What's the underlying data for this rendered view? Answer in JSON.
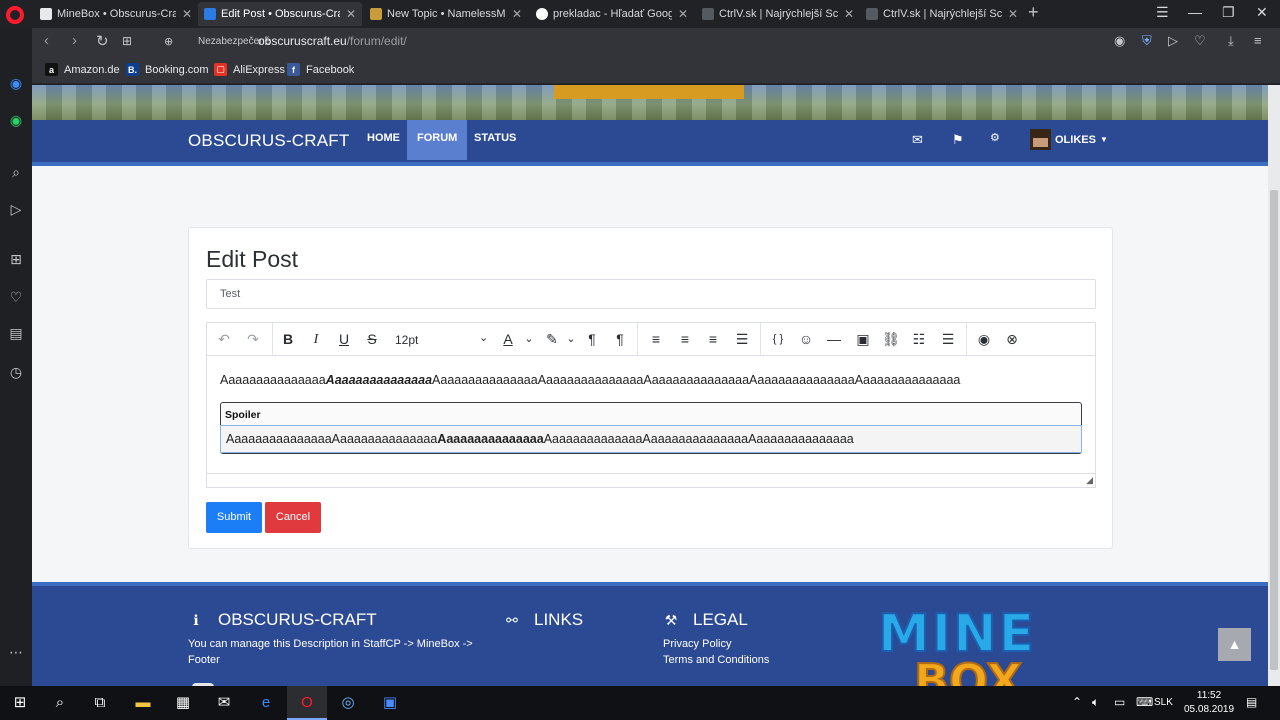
{
  "browser": {
    "tabs": [
      {
        "title": "MineBox • Obscurus-Craft",
        "favicon_color": "#e8e9eb"
      },
      {
        "title": "Edit Post • Obscurus-Craft",
        "favicon_color": "#2c7be5"
      },
      {
        "title": "New Topic • NamelessMC",
        "favicon_color": "#c89b3c"
      },
      {
        "title": "prekladac - Hľadať Googlom",
        "favicon_color": "#ffffff"
      },
      {
        "title": "CtrlV.sk | Najrýchlejší Screen",
        "favicon_color": "#555a60"
      },
      {
        "title": "CtrlV.sk | Najrýchlejší Screen",
        "favicon_color": "#555a60"
      }
    ],
    "security_label": "Nezabezpečené",
    "url_host": "obscuruscraft.eu",
    "url_path": "/forum/edit/",
    "bookmarks": [
      {
        "label": "Amazon.de",
        "icon": "a",
        "color": "#111111"
      },
      {
        "label": "Booking.com",
        "icon": "B.",
        "color": "#0b3f91"
      },
      {
        "label": "AliExpress",
        "icon": "▢",
        "color": "#e43225"
      },
      {
        "label": "Facebook",
        "icon": "f",
        "color": "#3b5998"
      }
    ]
  },
  "site": {
    "brand": "OBSCURUS-CRAFT",
    "nav": [
      {
        "label": "HOME"
      },
      {
        "label": "FORUM"
      },
      {
        "label": "STATUS"
      }
    ],
    "username": "OLIKES"
  },
  "editor": {
    "page_title": "Edit Post",
    "topic_title_value": "Test",
    "font_size": "12pt",
    "paragraph": {
      "part1": "Aaaaaaaaaaaaaaa",
      "bold": "Aaaaaaaaaaaaaaa",
      "part2": "AaaaaaaaaaaaaaaAaaaaaaaaaaaaaaAaaaaaaaaaaaaaaAaaaaaaaaaaaaaaAaaaaaaaaaaaaaa"
    },
    "spoiler": {
      "label": "Spoiler",
      "part1": "AaaaaaaaaaaaaaaAaaaaaaaaaaaaaa",
      "bold": "Aaaaaaaaaaaaaaa",
      "part2": "AaaaaaaaaaaaaaAaaaaaaaaaaaaaaAaaaaaaaaaaaaaa"
    },
    "submit_label": "Submit",
    "cancel_label": "Cancel"
  },
  "footer": {
    "col1_title": "OBSCURUS-CRAFT",
    "col1_text_line1": "You can manage this Description in StaffCP -> MineBox ->",
    "col1_text_line2": "Footer",
    "col2_title": "LINKS",
    "col3_title": "LEGAL",
    "legal_links": [
      "Privacy Policy",
      "Terms and Conditions"
    ],
    "logo_line1": "MINE",
    "logo_line2": "BOX"
  },
  "taskbar": {
    "language": "SLK",
    "time": "11:52",
    "date": "05.08.2019"
  }
}
